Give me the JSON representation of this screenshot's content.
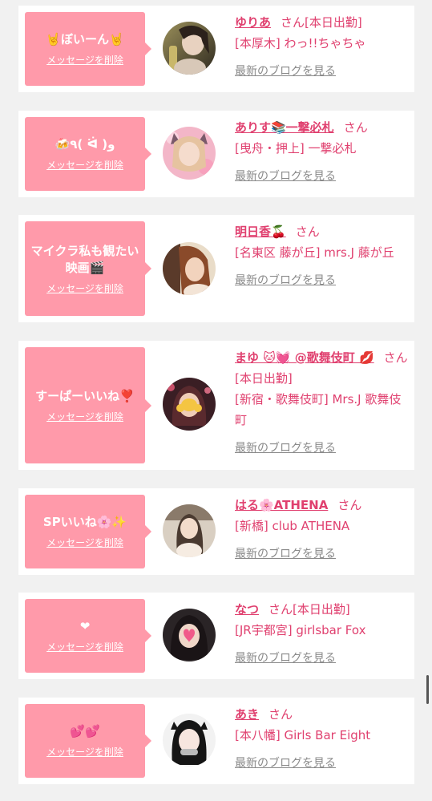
{
  "cards": [
    {
      "bubble_text": "🤘ぼいーん🤘",
      "delete_label": "メッセージを削除",
      "name": "ゆりあ",
      "san": "さん",
      "status": "[本日出勤]",
      "shop": "[本厚木] わっ!!ちゃちゃ",
      "blog_label": "最新のブログを見る"
    },
    {
      "bubble_text": "🍻٩( ᐛ )و",
      "delete_label": "メッセージを削除",
      "name": "ありす📚一撃必札",
      "san": "さん",
      "status": "",
      "shop": "[曳舟・押上] 一撃必札",
      "blog_label": "最新のブログを見る"
    },
    {
      "bubble_text": "マイクラ私も観たい映画🎬",
      "delete_label": "メッセージを削除",
      "name": "明日香🍒",
      "san": "さん",
      "status": "",
      "shop": "[名東区 藤が丘] mrs.J 藤が丘",
      "blog_label": "最新のブログを見る"
    },
    {
      "bubble_text": "すーぱーいいね❣️",
      "delete_label": "メッセージを削除",
      "name": "まゆ 🐱💓 @歌舞伎町 💋",
      "san": "さん",
      "status": "[本日出勤]",
      "shop": "[新宿・歌舞伎町] Mrs.J 歌舞伎町",
      "blog_label": "最新のブログを見る"
    },
    {
      "bubble_text": "SPいいね🌸✨",
      "delete_label": "メッセージを削除",
      "name": "はる🌸ATHENA",
      "san": "さん",
      "status": "",
      "shop": "[新橋] club ATHENA",
      "blog_label": "最新のブログを見る"
    },
    {
      "bubble_text": "❤",
      "delete_label": "メッセージを削除",
      "name": "なつ",
      "san": "さん",
      "status": "[本日出勤]",
      "shop": "[JR宇都宮] girlsbar Fox",
      "blog_label": "最新のブログを見る"
    },
    {
      "bubble_text": "💕💕",
      "delete_label": "メッセージを削除",
      "name": "あき",
      "san": "さん",
      "status": "",
      "shop": "[本八幡] Girls Bar Eight",
      "blog_label": "最新のブログを見る"
    }
  ],
  "colors": {
    "accent": "#e0406f",
    "bubble": "#ff9aaa",
    "muted": "#8a8a8a",
    "background": "#f1f1f1"
  },
  "icons": [
    "avatar-photo"
  ]
}
